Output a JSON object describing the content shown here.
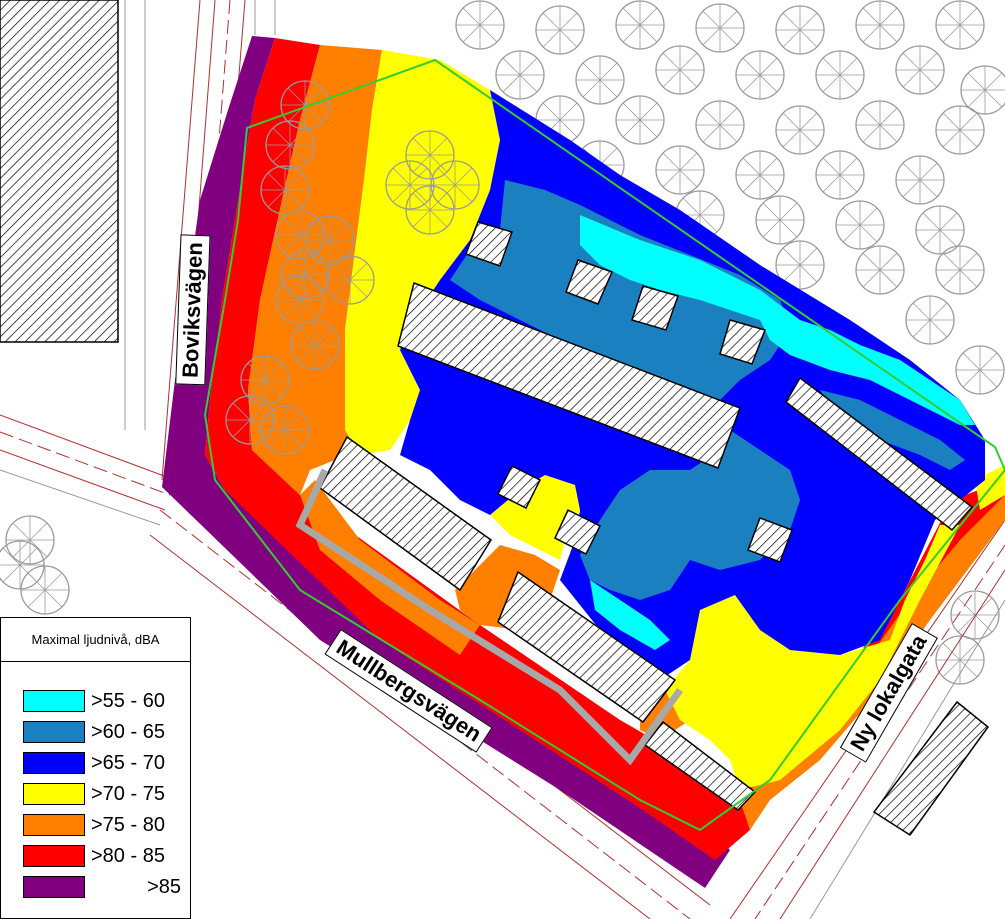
{
  "legend": {
    "title": "Maximal ljudnivå, dBA",
    "items": [
      {
        "label": ">55 - 60",
        "color": "#00ffff"
      },
      {
        "label": ">60 - 65",
        "color": "#1a80c0"
      },
      {
        "label": ">65 - 70",
        "color": "#0000ff"
      },
      {
        "label": ">70 - 75",
        "color": "#ffff00"
      },
      {
        "label": ">75 - 80",
        "color": "#ff8000"
      },
      {
        "label": ">80 - 85",
        "color": "#ff0000"
      },
      {
        "label": ">85",
        "color": "#800080"
      }
    ]
  },
  "streets": {
    "boviksvagen": "Boviksvägen",
    "mullbergsvagen": "Mullbergsvägen",
    "ny_lokalgata": "Ny lokalgata"
  },
  "colors": {
    "boundary": "#33cc33",
    "road_line": "#b03030",
    "tree_outline": "#a0a0a0",
    "building_fill": "#ffffff"
  }
}
